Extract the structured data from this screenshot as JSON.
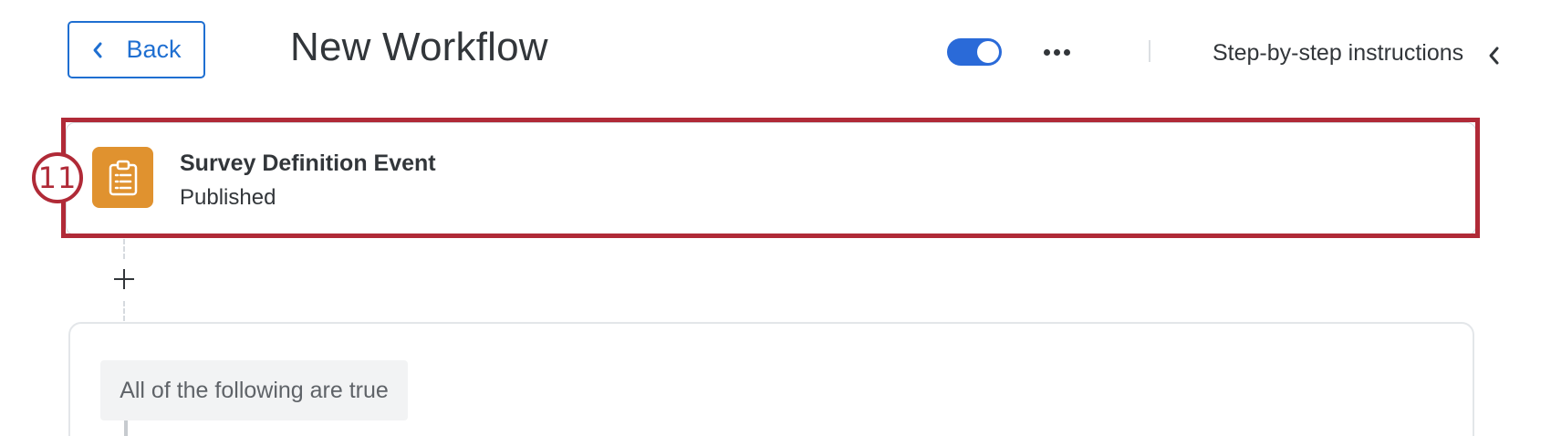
{
  "header": {
    "back_label": "Back",
    "title": "New Workflow",
    "toggle_on": true,
    "instructions_label": "Step-by-step instructions"
  },
  "event": {
    "step_number": "11",
    "title": "Survey Definition Event",
    "subtitle": "Published",
    "icon": "clipboard-icon",
    "icon_color": "#e0922f"
  },
  "condition": {
    "label": "All of the following are true"
  },
  "colors": {
    "accent": "#1f6fd1",
    "toggle": "#2a6ad8",
    "highlight": "#b02a37",
    "text": "#32363a"
  }
}
